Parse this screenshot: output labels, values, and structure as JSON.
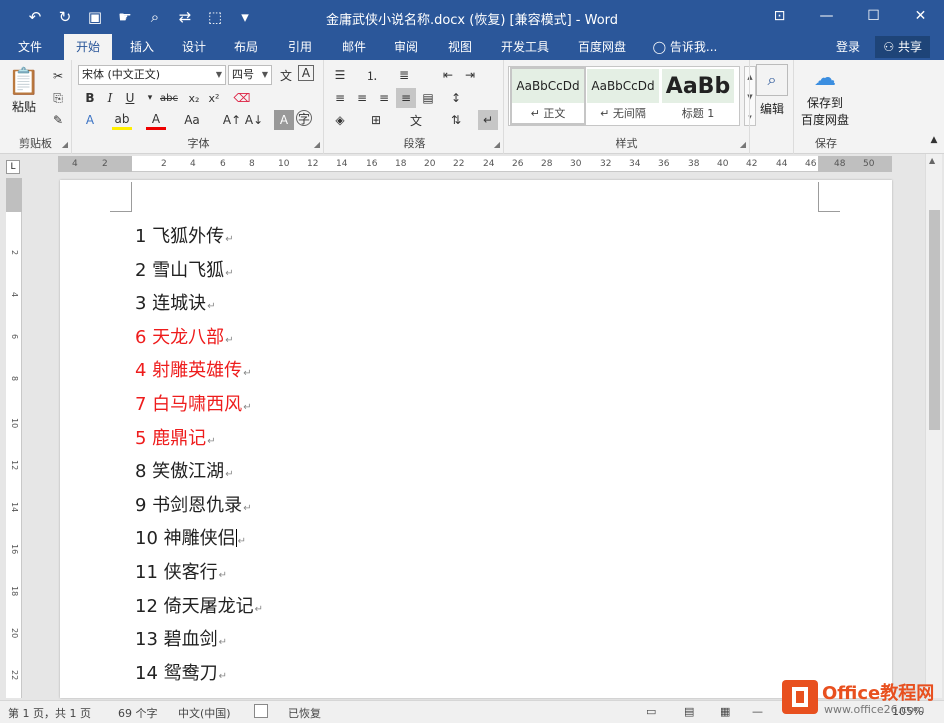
{
  "window": {
    "title": "金庸武侠小说名称.docx (恢复) [兼容模式] - Word",
    "quick_access": [
      "undo-icon",
      "redo-icon",
      "save-icon",
      "touch-mode-icon",
      "print-preview-icon",
      "replace-icon",
      "select-icon",
      "customize-icon"
    ]
  },
  "tabs": [
    {
      "label": "文件",
      "active": false
    },
    {
      "label": "开始",
      "active": true
    },
    {
      "label": "插入",
      "active": false
    },
    {
      "label": "设计",
      "active": false
    },
    {
      "label": "布局",
      "active": false
    },
    {
      "label": "引用",
      "active": false
    },
    {
      "label": "邮件",
      "active": false
    },
    {
      "label": "审阅",
      "active": false
    },
    {
      "label": "视图",
      "active": false
    },
    {
      "label": "开发工具",
      "active": false
    },
    {
      "label": "百度网盘",
      "active": false
    }
  ],
  "tell_me": "告诉我...",
  "login": "登录",
  "share": "共享",
  "ribbon": {
    "clipboard": {
      "label": "剪贴板",
      "paste": "粘贴"
    },
    "font": {
      "label": "字体",
      "font_name": "宋体 (中文正文)",
      "font_size": "四号"
    },
    "paragraph": {
      "label": "段落"
    },
    "styles": {
      "label": "样式",
      "items": [
        {
          "preview": "AaBbCcDd",
          "name": "正文"
        },
        {
          "preview": "AaBbCcDd",
          "name": "无间隔"
        },
        {
          "preview": "AaBb",
          "name": "标题 1"
        }
      ]
    },
    "edit": {
      "label": "编辑"
    },
    "save": {
      "big_label_1": "保存到",
      "big_label_2": "百度网盘",
      "label": "保存"
    }
  },
  "ruler_h": [
    "4",
    "2",
    "2",
    "4",
    "6",
    "8",
    "10",
    "12",
    "14",
    "16",
    "18",
    "20",
    "22",
    "24",
    "26",
    "28",
    "30",
    "32",
    "34",
    "36",
    "38",
    "40",
    "42",
    "44",
    "46",
    "48",
    "50"
  ],
  "ruler_v": [
    "2",
    "4",
    "6",
    "8",
    "10",
    "12",
    "14",
    "16",
    "18",
    "20",
    "22"
  ],
  "document": {
    "lines": [
      {
        "text": "1 飞狐外传",
        "red": false
      },
      {
        "text": "2 雪山飞狐",
        "red": false
      },
      {
        "text": "3 连城诀",
        "red": false
      },
      {
        "text": "6 天龙八部",
        "red": true
      },
      {
        "text": "4 射雕英雄传",
        "red": true
      },
      {
        "text": "7 白马啸西风",
        "red": true
      },
      {
        "text": "5 鹿鼎记",
        "red": true
      },
      {
        "text": "8 笑傲江湖",
        "red": false
      },
      {
        "text": "9 书剑恩仇录",
        "red": false
      },
      {
        "text": "10 神雕侠侣",
        "red": false
      },
      {
        "text": "11 侠客行",
        "red": false
      },
      {
        "text": "12 倚天屠龙记",
        "red": false
      },
      {
        "text": "13 碧血剑",
        "red": false
      },
      {
        "text": "14 鸳鸯刀",
        "red": false
      }
    ],
    "colors": {
      "red": "#ee1c1c",
      "normal": "#222222"
    }
  },
  "status": {
    "page": "第 1 页，共 1 页",
    "words": "69 个字",
    "lang": "中文(中国)",
    "recovered": "已恢复",
    "zoom": "105%"
  },
  "watermark": {
    "line1": "Office教程网",
    "line2": "www.office26.com"
  },
  "colors": {
    "brand": "#2b579a",
    "accent_red": "#ee1c1c",
    "watermark": "#e8501f"
  }
}
